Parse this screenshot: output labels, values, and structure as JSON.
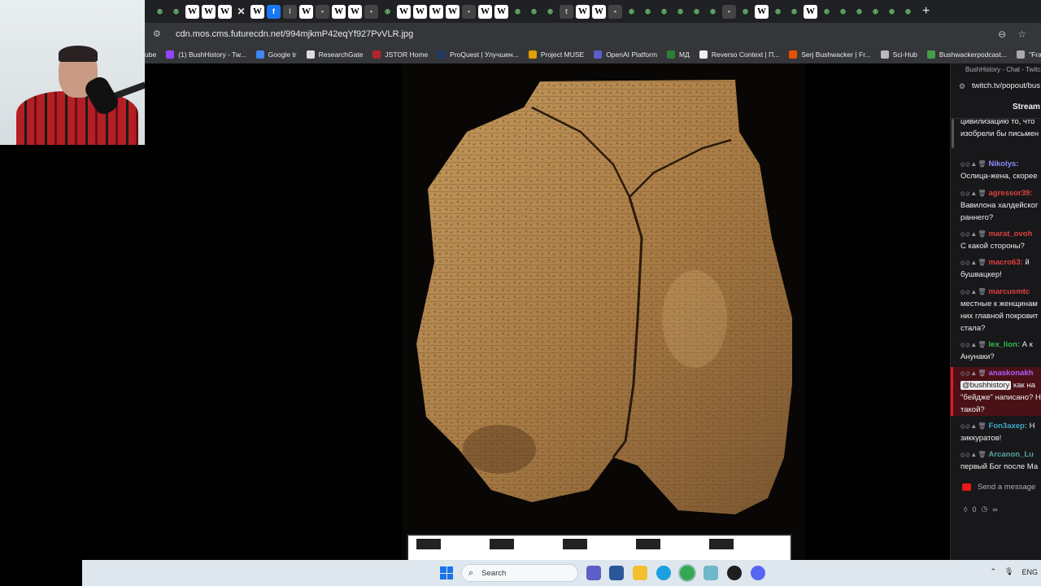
{
  "browser": {
    "url": "cdn.mos.cms.futurecdn.net/994mjkmP42eqYf927PvVLR.jpg",
    "tab_icons": [
      "o",
      "o",
      "W",
      "W",
      "W",
      "close",
      "W",
      "f",
      "I",
      "W",
      "x",
      "W",
      "W",
      "x",
      "o",
      "W",
      "W",
      "W",
      "W",
      "x",
      "W",
      "W",
      "o",
      "o",
      "o",
      "t",
      "W",
      "W",
      "x",
      "o",
      "o",
      "o",
      "o",
      "o",
      "o",
      "x",
      "o",
      "W",
      "o",
      "o",
      "W",
      "o",
      "o",
      "o",
      "o",
      "o",
      "o"
    ],
    "new_tab": "+",
    "bookmarks": [
      {
        "label": "ube",
        "color": "#e8eaed"
      },
      {
        "label": "(1) BushHistory - Tw...",
        "color": "#9147ff"
      },
      {
        "label": "Google tr",
        "color": "#4285f4"
      },
      {
        "label": "ResearchGate",
        "color": "#dddddd"
      },
      {
        "label": "JSTOR Home",
        "color": "#b2262a"
      },
      {
        "label": "ProQuest | Улучшен...",
        "color": "#1e3a5f"
      },
      {
        "label": "Project MUSE",
        "color": "#e0a000"
      },
      {
        "label": "OpenAI Platform",
        "color": "#5b5fc7"
      },
      {
        "label": "МД",
        "color": "#2e7d32"
      },
      {
        "label": "Reverso Context | П...",
        "color": "#eeeeee"
      },
      {
        "label": "Serj Bushwacker | Fr...",
        "color": "#e65100"
      },
      {
        "label": "Sci-Hub",
        "color": "#bbbbbb"
      },
      {
        "label": "Bushwackerpodcast...",
        "color": "#43a047"
      },
      {
        "label": "\"France is my moth...",
        "color": "#aaaaaa"
      }
    ]
  },
  "chat": {
    "window_title": "BushHistory - Chat - Twitch",
    "url": "twitch.tv/popout/bus",
    "header": "Stream",
    "mod_icons": "⦸⊘▲🗑",
    "messages": [
      {
        "user": "",
        "user_color": "#efeff1",
        "lines": [
          "цивилизацию то, что",
          "изобрели бы письмен"
        ]
      },
      {
        "user": "Nikolys:",
        "user_color": "#8a8aff",
        "lines": [
          "Ослица-жена, скорее"
        ]
      },
      {
        "user": "agressor39:",
        "user_color": "#e0403f",
        "lines": [
          "Вавилона халдейског",
          "раннего?"
        ]
      },
      {
        "user": "marat_ovoh",
        "user_color": "#e0403f",
        "lines": [
          "С какой стороны?"
        ]
      },
      {
        "user": "macro63:",
        "user_color": "#e0403f",
        "lines": [
          "бушвацкер!"
        ]
      },
      {
        "user": "marcusmtc",
        "user_color": "#e0403f",
        "lines": [
          "местные к женщинам",
          "них главной покровит",
          "стала?"
        ]
      },
      {
        "user": "lex_lion:",
        "user_color": "#2ebd4e",
        "lines": [
          "Анунаки?"
        ]
      },
      {
        "user": "anaskonakh",
        "user_color": "#b05cff",
        "mention": "@bushhistory",
        "lines": [
          "\"бейдже\" написано? Н",
          "такой?"
        ]
      },
      {
        "user": "Fon3axep:",
        "user_color": "#3ea6c7",
        "lines": [
          "зиккуратов!"
        ]
      },
      {
        "user": "Arcanon_Lu",
        "user_color": "#5aa0a0",
        "lines": [
          "первый Бог после Ма"
        ]
      }
    ],
    "msg_first_inline": {
      "macro63": "й",
      "lex_lion": "А к",
      "Fon3axep": "Н",
      "marcusmtc": "",
      "agressor39": "",
      "Nikolys": "",
      "marat_ovoh": "",
      "anaskonakh": "как на",
      "Arcanon_Lu": ""
    },
    "send_placeholder": "Send a message",
    "points": "0",
    "points_suffix": "∞"
  },
  "taskbar": {
    "search_label": "Search",
    "lang": "ENG"
  }
}
